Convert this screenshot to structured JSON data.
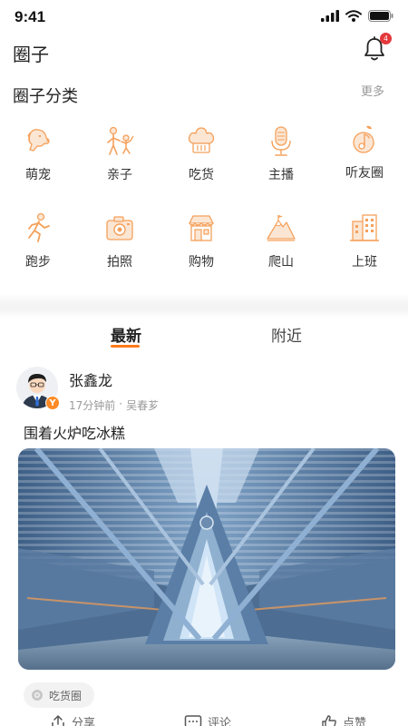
{
  "status_bar": {
    "time": "9:41"
  },
  "header": {
    "title": "圈子",
    "notification_count": "4"
  },
  "categories": {
    "title": "圈子分类",
    "more_label": "更多",
    "items": [
      {
        "label": "萌宠",
        "icon": "pet-dog-icon"
      },
      {
        "label": "亲子",
        "icon": "parent-child-icon"
      },
      {
        "label": "吃货",
        "icon": "chef-hat-icon"
      },
      {
        "label": "主播",
        "icon": "microphone-icon"
      },
      {
        "label": "听友圈",
        "icon": "music-note-icon"
      },
      {
        "label": "跑步",
        "icon": "running-icon"
      },
      {
        "label": "拍照",
        "icon": "camera-icon"
      },
      {
        "label": "购物",
        "icon": "shop-icon"
      },
      {
        "label": "爬山",
        "icon": "mountain-icon"
      },
      {
        "label": "上班",
        "icon": "office-building-icon"
      }
    ]
  },
  "tabs": [
    {
      "label": "最新",
      "active": true
    },
    {
      "label": "附近",
      "active": false
    }
  ],
  "post": {
    "user": "张鑫龙",
    "time": "17分钟前",
    "separator": "·",
    "location": "吴春芗",
    "badge": "Y",
    "text": "围着火炉吃冰糕",
    "tag": "吃货圈"
  },
  "actions": {
    "share": "分享",
    "comment": "评论",
    "like": "点赞"
  },
  "colors": {
    "accent": "#ff7a1a",
    "icon_orange": "#f5a05a",
    "badge_red": "#e4393c"
  }
}
